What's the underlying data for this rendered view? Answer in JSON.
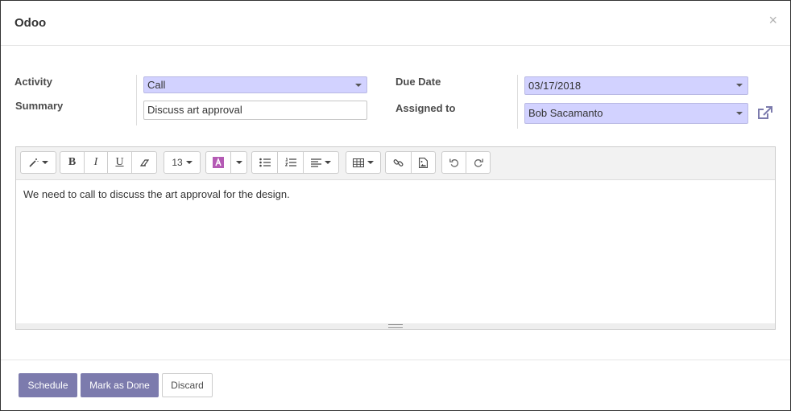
{
  "dialog": {
    "title": "Odoo",
    "close_label": "×"
  },
  "form": {
    "activity": {
      "label": "Activity",
      "value": "Call"
    },
    "summary": {
      "label": "Summary",
      "value": "Discuss art approval"
    },
    "due_date": {
      "label": "Due Date",
      "value": "03/17/2018"
    },
    "assigned_to": {
      "label": "Assigned to",
      "value": "Bob Sacamanto"
    }
  },
  "editor": {
    "toolbar": {
      "font_size": "13",
      "bold": "B",
      "italic": "I",
      "underline": "U"
    },
    "content": "We need to call to discuss the art approval for the design."
  },
  "footer": {
    "schedule_label": "Schedule",
    "mark_done_label": "Mark as Done",
    "discard_label": "Discard"
  },
  "colors": {
    "primary": "#7c7bad",
    "selection": "#d2d2ff",
    "link": "#7c7bad"
  }
}
